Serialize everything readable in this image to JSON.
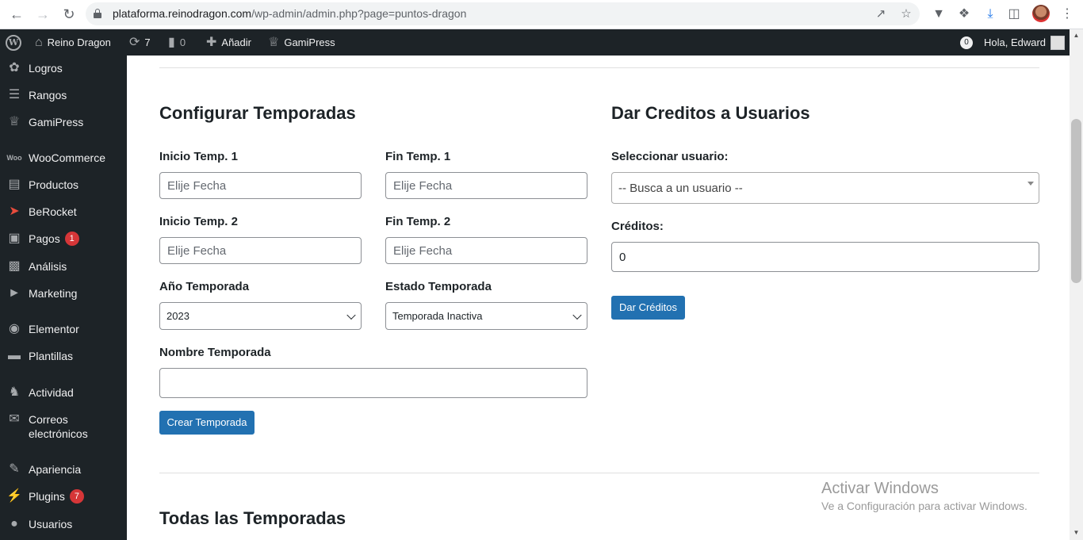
{
  "browser": {
    "url_host": "plataforma.reinodragon.com",
    "url_path": "/wp-admin/admin.php?page=puntos-dragon"
  },
  "adminbar": {
    "site_name": "Reino Dragon",
    "updates_count": "7",
    "comments_count": "0",
    "add_new": "Añadir",
    "gamipress": "GamiPress",
    "notification_count": "0",
    "greeting": "Hola, Edward"
  },
  "sidebar": {
    "items": [
      {
        "label": "Logros",
        "icon": "award-icon"
      },
      {
        "label": "Rangos",
        "icon": "ranks-icon"
      },
      {
        "label": "GamiPress",
        "icon": "crown-icon"
      },
      {
        "label": "WooCommerce",
        "icon": "woo-icon"
      },
      {
        "label": "Productos",
        "icon": "archive-icon"
      },
      {
        "label": "BeRocket",
        "icon": "rocket-icon"
      },
      {
        "label": "Pagos",
        "icon": "payments-icon",
        "badge": "1"
      },
      {
        "label": "Análisis",
        "icon": "chart-icon"
      },
      {
        "label": "Marketing",
        "icon": "megaphone-icon"
      },
      {
        "label": "Elementor",
        "icon": "elementor-icon"
      },
      {
        "label": "Plantillas",
        "icon": "folder-icon"
      },
      {
        "label": "Actividad",
        "icon": "activity-icon"
      },
      {
        "label": "Correos electrónicos",
        "icon": "email-icon"
      },
      {
        "label": "Apariencia",
        "icon": "brush-icon"
      },
      {
        "label": "Plugins",
        "icon": "plugin-icon",
        "badge": "7"
      },
      {
        "label": "Usuarios",
        "icon": "user-icon"
      }
    ]
  },
  "seasons": {
    "title": "Configurar Temporadas",
    "start1_label": "Inicio Temp. 1",
    "end1_label": "Fin Temp. 1",
    "start2_label": "Inicio Temp. 2",
    "end2_label": "Fin Temp. 2",
    "date_placeholder": "Elije Fecha",
    "year_label": "Año Temporada",
    "year_value": "2023",
    "status_label": "Estado Temporada",
    "status_value": "Temporada Inactiva",
    "name_label": "Nombre Temporada",
    "name_value": "",
    "create_button": "Crear Temporada"
  },
  "credits": {
    "title": "Dar Creditos a Usuarios",
    "user_label": "Seleccionar usuario:",
    "user_placeholder": "-- Busca a un usuario --",
    "credits_label": "Créditos:",
    "credits_value": "0",
    "submit_button": "Dar Créditos"
  },
  "all_seasons": {
    "title": "Todas las Temporadas"
  },
  "watermark": {
    "title": "Activar Windows",
    "subtitle": "Ve a Configuración para activar Windows."
  }
}
